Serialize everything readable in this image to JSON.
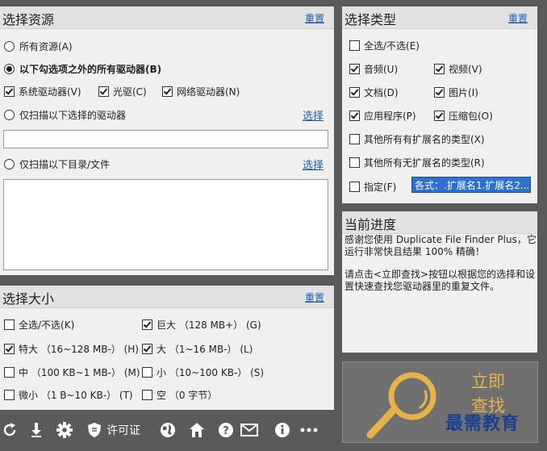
{
  "sources": {
    "title": "选择资源",
    "reset": "重置",
    "all": "所有资源(A)",
    "except": "以下勾选项之外的所有驱动器(B)",
    "system_drive": "系统驱动器(V)",
    "optical": "光驱(C)",
    "network": "网络驱动器(N)",
    "only_drives": "仅扫描以下选择的驱动器",
    "only_dirs": "仅扫描以下目录/文件",
    "select_link": "选择",
    "select_link2": "选择"
  },
  "types": {
    "title": "选择类型",
    "reset": "重置",
    "all": "全选/不选(E)",
    "audio": "音频(U)",
    "video": "视频(V)",
    "doc": "文档(D)",
    "image": "图片(I)",
    "app": "应用程序(P)",
    "archive": "压缩包(O)",
    "other_ext": "其他所有有扩展名的类型(X)",
    "other_noext": "其他所有无扩展名的类型(R)",
    "specify": "指定(F)",
    "specify_value": "各式：.扩展名1.扩展名2..."
  },
  "progress": {
    "title": "当前进度",
    "line1": "感谢您使用 Duplicate File Finder Plus，它运行非常快且结果 100% 精确！",
    "line2": "请点击<立即查找>按钮以根据您的选择和设置快速查找您驱动器里的重复文件。"
  },
  "sizes": {
    "title": "选择大小",
    "reset": "重置",
    "all": "全选/不选(K)",
    "huge": "巨大 （128 MB+） (G)",
    "xlarge": "特大 （16~128 MB-） (H)",
    "large": "大 （1~16 MB-） (L)",
    "medium": "中 （100 KB~1 MB-） (M)",
    "small": "小 （10~100 KB-） (S)",
    "tiny": "微小 （1 B~10 KB-） (T)",
    "empty": "空 （0 字节）"
  },
  "find_button": {
    "line1": "立即",
    "line2": "查找"
  },
  "toolbar": {
    "license": "许可证"
  },
  "watermark": "最需教育",
  "colors": {
    "accent_link": "#1a5fb4",
    "find_text": "#e7b24a",
    "selection": "#2f6fd0"
  }
}
